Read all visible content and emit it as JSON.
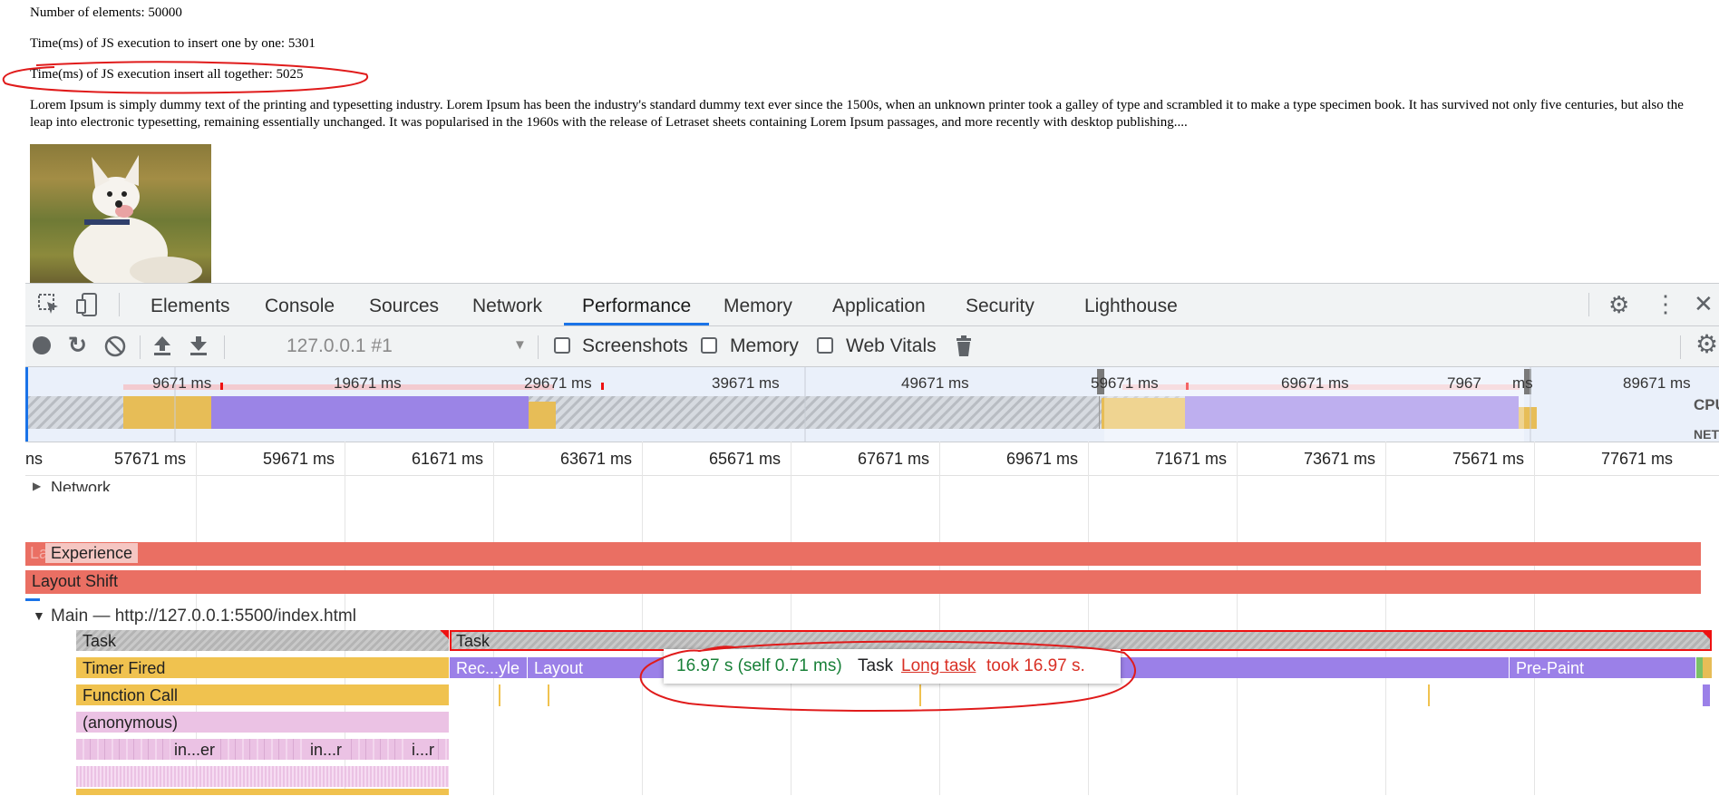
{
  "page": {
    "elements_line": "Number of elements: 50000",
    "one_by_one_line": "Time(ms) of JS execution to insert one by one: 5301",
    "together_line": "Time(ms) of JS execution insert all together: 5025",
    "lorem": "Lorem Ipsum is simply dummy text of the printing and typesetting industry. Lorem Ipsum has been the industry's standard dummy text ever since the 1500s, when an unknown printer took a galley of type and scrambled it to make a type specimen book. It has survived not only five centuries, but also the leap into electronic typesetting, remaining essentially unchanged. It was popularised in the 1960s with the release of Letraset sheets containing Lorem Ipsum passages, and more recently with desktop publishing...."
  },
  "devtools": {
    "tabs": [
      "Elements",
      "Console",
      "Sources",
      "Network",
      "Performance",
      "Memory",
      "Application",
      "Security",
      "Lighthouse"
    ],
    "active_tab": "Performance",
    "toolbar": {
      "target": "127.0.0.1 #1",
      "screenshots": "Screenshots",
      "memory": "Memory",
      "web_vitals": "Web Vitals"
    },
    "overview": {
      "labels": [
        "9671 ms",
        "19671 ms",
        "29671 ms",
        "39671 ms",
        "49671 ms",
        "59671 ms",
        "69671 ms",
        "7967",
        "ms",
        "89671 ms"
      ],
      "cpu": "CPU",
      "net": "NET"
    },
    "ruler": [
      "ns",
      "57671 ms",
      "59671 ms",
      "61671 ms",
      "63671 ms",
      "65671 ms",
      "67671 ms",
      "69671 ms",
      "71671 ms",
      "73671 ms",
      "75671 ms",
      "77671 ms"
    ],
    "tracks": {
      "network": "Network",
      "experience_prefix": "La",
      "experience": "Experience",
      "layout_shift": "Layout Shift",
      "main": "Main — http://127.0.0.1:5500/index.html"
    },
    "flame": {
      "task1": "Task",
      "task2": "Task",
      "timer": "Timer Fired",
      "recalc": "Rec...yle",
      "layout": "Layout",
      "prepaint": "Pre-Paint",
      "function_call": "Function Call",
      "anonymous": "(anonymous)",
      "in1": "in...er",
      "in2": "in...r",
      "in3": "i...r"
    },
    "tooltip": {
      "time": "16.97 s (self 0.71 ms)",
      "name": "Task",
      "link": "Long task",
      "rest": "took 16.97 s."
    },
    "colors": {
      "accent": "#1a73e8",
      "scripting": "#f0c24f",
      "rendering": "#9b80e8",
      "experience": "#ea6f63",
      "function": "#ebc2e4",
      "tooltip_green": "#188038",
      "tooltip_red": "#d93025"
    }
  }
}
